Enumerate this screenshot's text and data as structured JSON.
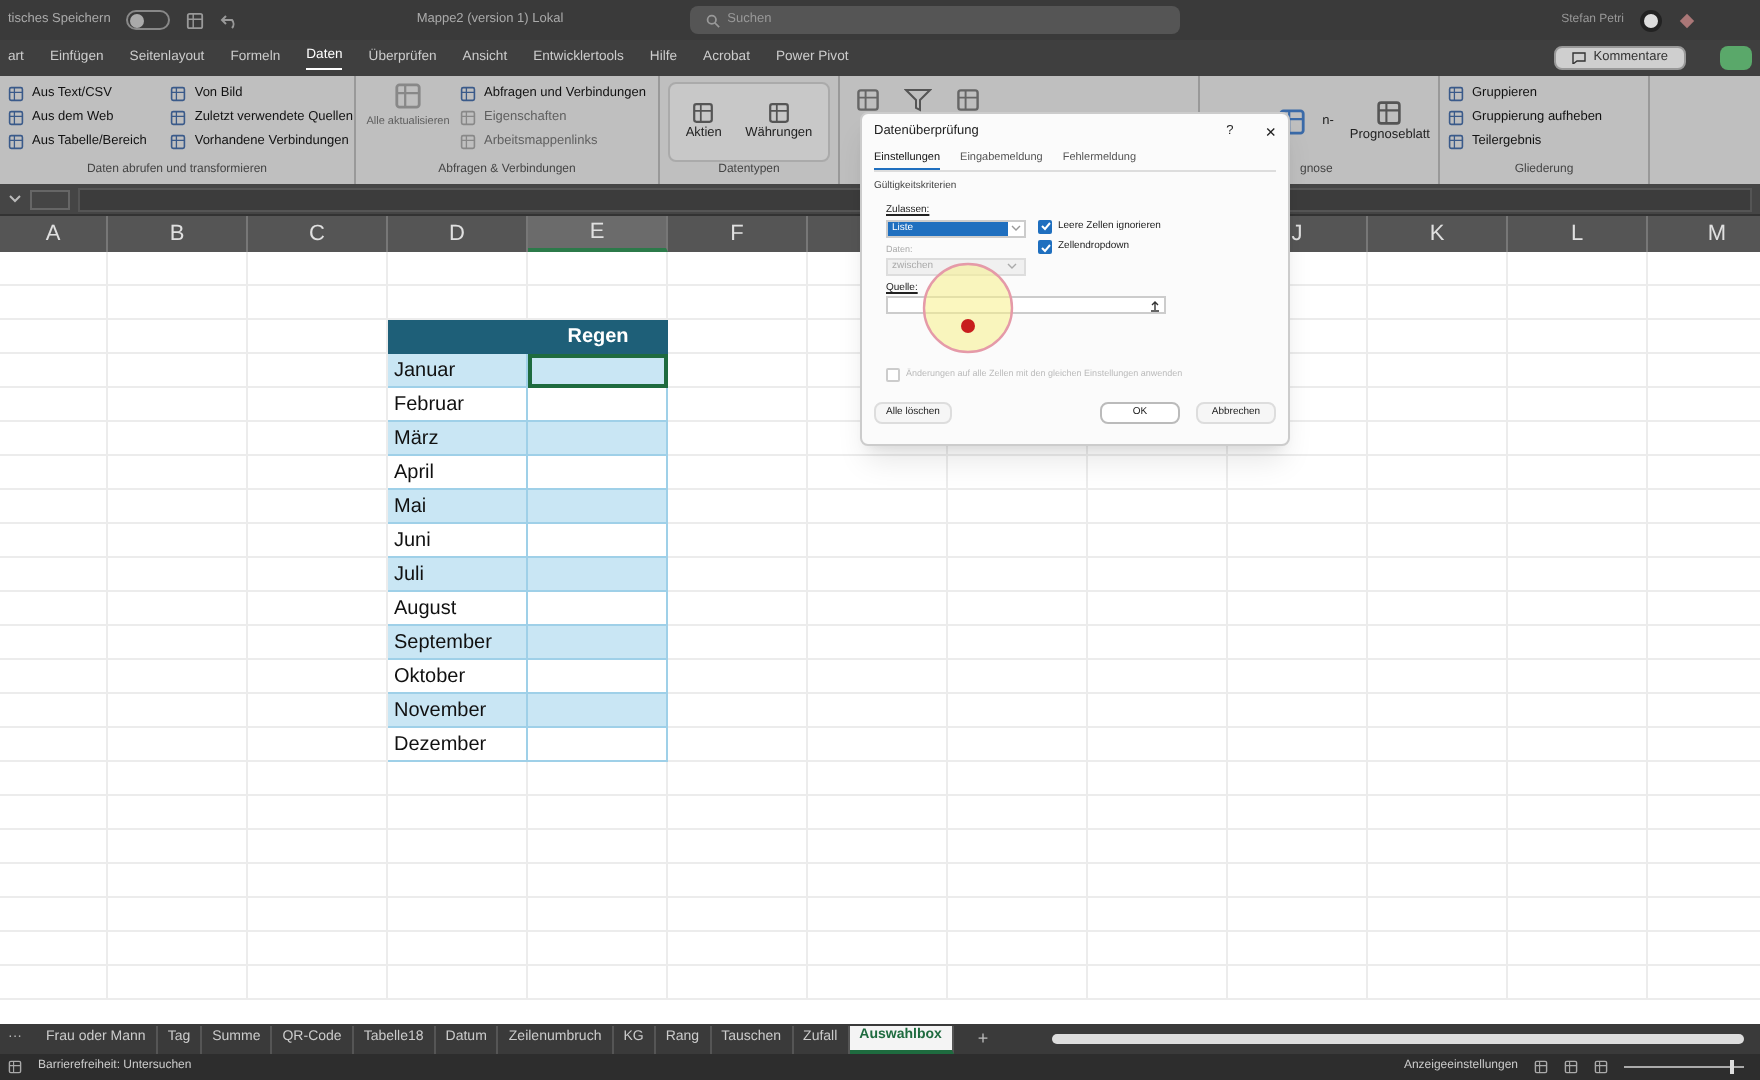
{
  "title_bar": {
    "autosave_label": "tisches Speichern",
    "autosave_on": false,
    "file_name": "Mappe2 (version 1) Lokal",
    "search_placeholder": "Suchen",
    "user_name": "Stefan Petri"
  },
  "menu_tabs": [
    {
      "label": "art",
      "selected": false
    },
    {
      "label": "Einfügen",
      "selected": false
    },
    {
      "label": "Seitenlayout",
      "selected": false
    },
    {
      "label": "Formeln",
      "selected": false
    },
    {
      "label": "Daten",
      "selected": true
    },
    {
      "label": "Überprüfen",
      "selected": false
    },
    {
      "label": "Ansicht",
      "selected": false
    },
    {
      "label": "Entwicklertools",
      "selected": false
    },
    {
      "label": "Hilfe",
      "selected": false
    },
    {
      "label": "Acrobat",
      "selected": false
    },
    {
      "label": "Power Pivot",
      "selected": false
    }
  ],
  "comments_button": "Kommentare",
  "ribbon": {
    "get_data": {
      "items": [
        {
          "label": "Aus Text/CSV",
          "disabled": false
        },
        {
          "label": "Aus dem Web",
          "disabled": false
        },
        {
          "label": "Aus Tabelle/Bereich",
          "disabled": false
        },
        {
          "label": "Von Bild",
          "disabled": false
        },
        {
          "label": "Zuletzt verwendete Quellen",
          "disabled": false
        },
        {
          "label": "Vorhandene Verbindungen",
          "disabled": false
        }
      ],
      "label": "Daten abrufen und transformieren"
    },
    "queries": {
      "refresh": "Alle aktualisieren",
      "items": [
        {
          "label": "Abfragen und Verbindungen",
          "disabled": false
        },
        {
          "label": "Eigenschaften",
          "disabled": true
        },
        {
          "label": "Arbeitsmappenlinks",
          "disabled": true
        }
      ],
      "label": "Abfragen & Verbindungen"
    },
    "data_types": {
      "items": [
        "Aktien",
        "Währungen"
      ],
      "label": "Datentypen"
    },
    "forecast": {
      "items": [
        "n-",
        "Prognoseblatt"
      ],
      "label": "gnose"
    },
    "outline": {
      "items": [
        "Gruppieren",
        "Gruppierung aufheben",
        "Teilergebnis"
      ],
      "label": "Gliederung"
    }
  },
  "columns": [
    {
      "label": "A",
      "selected": false
    },
    {
      "label": "B",
      "selected": false
    },
    {
      "label": "C",
      "selected": false
    },
    {
      "label": "D",
      "selected": false
    },
    {
      "label": "E",
      "selected": true
    },
    {
      "label": "F",
      "selected": false
    },
    {
      "label": "J",
      "selected": false
    },
    {
      "label": "K",
      "selected": false
    },
    {
      "label": "L",
      "selected": false
    },
    {
      "label": "M",
      "selected": false
    }
  ],
  "table": {
    "header": "Regen",
    "rows": [
      {
        "month": "Januar",
        "banded": true,
        "selected": true
      },
      {
        "month": "Februar",
        "banded": false,
        "selected": false
      },
      {
        "month": "März",
        "banded": true,
        "selected": false
      },
      {
        "month": "April",
        "banded": false,
        "selected": false
      },
      {
        "month": "Mai",
        "banded": true,
        "selected": false
      },
      {
        "month": "Juni",
        "banded": false,
        "selected": false
      },
      {
        "month": "Juli",
        "banded": true,
        "selected": false
      },
      {
        "month": "August",
        "banded": false,
        "selected": false
      },
      {
        "month": "September",
        "banded": true,
        "selected": false
      },
      {
        "month": "Oktober",
        "banded": false,
        "selected": false
      },
      {
        "month": "November",
        "banded": true,
        "selected": false
      },
      {
        "month": "Dezember",
        "banded": false,
        "selected": false
      }
    ]
  },
  "dialog": {
    "title": "Datenüberprüfung",
    "help": "?",
    "close": "×",
    "tabs": [
      {
        "label": "Einstellungen",
        "selected": true
      },
      {
        "label": "Eingabemeldung",
        "selected": false
      },
      {
        "label": "Fehlermeldung",
        "selected": false
      }
    ],
    "section": "Gültigkeitskriterien",
    "allow_label": "Zulassen:",
    "allow_value": "Liste",
    "checks": [
      {
        "label": "Leere Zellen ignorieren",
        "checked": true
      },
      {
        "label": "Zellendropdown",
        "checked": true
      }
    ],
    "data_label": "Daten:",
    "data_value": "zwischen",
    "data_disabled": true,
    "source_label": "Quelle:",
    "apply_all": {
      "label": "Änderungen auf alle Zellen mit den gleichen Einstellungen anwenden",
      "checked": false,
      "disabled": true
    },
    "clear_button": "Alle löschen",
    "ok_button": "OK",
    "cancel_button": "Abbrechen"
  },
  "sheet_tabs": [
    {
      "label": "Frau oder Mann",
      "selected": false
    },
    {
      "label": "Tag",
      "selected": false
    },
    {
      "label": "Summe",
      "selected": false
    },
    {
      "label": "QR-Code",
      "selected": false
    },
    {
      "label": "Tabelle18",
      "selected": false
    },
    {
      "label": "Datum",
      "selected": false
    },
    {
      "label": "Zeilenumbruch",
      "selected": false
    },
    {
      "label": "KG",
      "selected": false
    },
    {
      "label": "Rang",
      "selected": false
    },
    {
      "label": "Tauschen",
      "selected": false
    },
    {
      "label": "Zufall",
      "selected": false
    },
    {
      "label": "Auswahlbox",
      "selected": true
    }
  ],
  "sheet_more": "···",
  "add_sheet": "+",
  "zoom": {
    "level": 0.9
  },
  "status_bar": {
    "accessibility": "Barrierefreiheit: Untersuchen",
    "display_settings": "Anzeigeeinstellungen"
  }
}
